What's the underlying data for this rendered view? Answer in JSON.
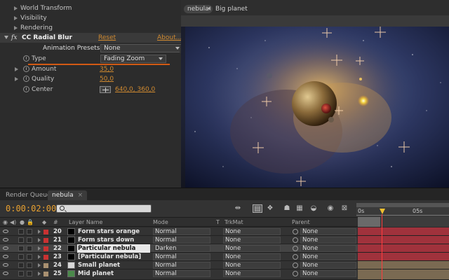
{
  "effect_controls": {
    "top_items": [
      {
        "label": "World Transform"
      },
      {
        "label": "Visibility"
      },
      {
        "label": "Rendering"
      }
    ],
    "effect": {
      "name": "CC Radial Blur",
      "reset_label": "Reset",
      "about_label": "About...",
      "presets_label": "Animation Presets:",
      "presets_value": "None",
      "properties": [
        {
          "label": "Type",
          "value": "Fading Zoom"
        },
        {
          "label": "Amount",
          "value": "35,0"
        },
        {
          "label": "Quality",
          "value": "50,0"
        },
        {
          "label": "Center",
          "value": "640,0, 360,0"
        }
      ]
    }
  },
  "viewer": {
    "breadcrumbs": [
      "nebula",
      "Big planet"
    ]
  },
  "timeline": {
    "tabs": [
      "Render Queue",
      "nebula"
    ],
    "timecode": "0:00:02:00",
    "ruler": [
      "0s",
      "05s"
    ],
    "columns": {
      "layer_name": "Layer Name",
      "mode": "Mode",
      "t": "T",
      "trkmat": "TrkMat",
      "parent": "Parent"
    },
    "layers": [
      {
        "num": "20",
        "name": "Form stars orange zone",
        "mode": "Normal",
        "trkmat": "None",
        "parent": "None",
        "color": "#c83232",
        "track_color": "#a0323c",
        "selected": false
      },
      {
        "num": "21",
        "name": "Form stars down",
        "mode": "Normal",
        "trkmat": "None",
        "parent": "None",
        "color": "#c83232",
        "track_color": "#a0323c",
        "selected": false
      },
      {
        "num": "22",
        "name": "Particular nebula blur",
        "mode": "Darken",
        "trkmat": "None",
        "parent": "None",
        "color": "#c83232",
        "track_color": "#a0323c",
        "selected": true
      },
      {
        "num": "23",
        "name": "[Particular nebula]",
        "mode": "Normal",
        "trkmat": "None",
        "parent": "None",
        "color": "#c83232",
        "track_color": "#a0323c",
        "selected": false
      },
      {
        "num": "24",
        "name": "Small planet",
        "mode": "Normal",
        "trkmat": "None",
        "parent": "None",
        "color": "#a89070",
        "track_color": "#7a6a52",
        "selected": false
      },
      {
        "num": "25",
        "name": "Mid planet",
        "mode": "Normal",
        "trkmat": "None",
        "parent": "None",
        "color": "#a89070",
        "track_color": "#7a6a52",
        "selected": false
      }
    ]
  },
  "colors": {
    "accent_orange": "#e08a2a",
    "playhead": "#ff3c3c"
  }
}
